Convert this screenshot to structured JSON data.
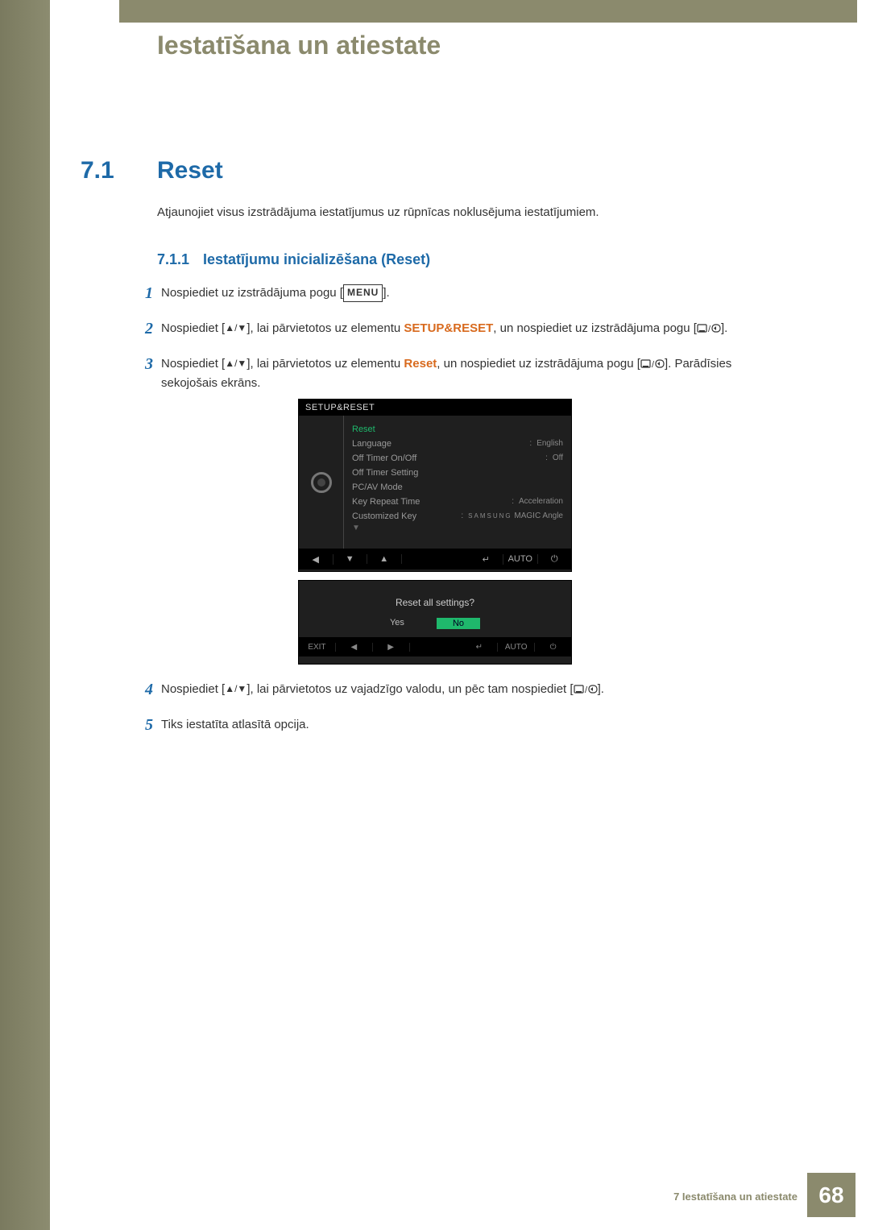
{
  "chapter_title": "Iestatīšana un atiestate",
  "section": {
    "num": "7.1",
    "title": "Reset"
  },
  "intro": "Atjaunojiet visus izstrādājuma iestatījumus uz rūpnīcas noklusējuma iestatījumiem.",
  "subsection": {
    "num": "7.1.1",
    "title": "Iestatījumu inicializēšana (Reset)"
  },
  "steps_top": [
    {
      "n": "1",
      "pre": "Nospiediet uz izstrādājuma pogu [",
      "icon": "menu",
      "post": "]."
    },
    {
      "n": "2",
      "pre": "Nospiediet [",
      "icon": "updown",
      "mid1": "], lai pārvietotos uz elementu ",
      "hl": "SETUP&RESET",
      "mid2": ", un nospiediet uz izstrādājuma pogu [",
      "icon2": "select-return",
      "post": "]."
    },
    {
      "n": "3",
      "pre": "Nospiediet [",
      "icon": "updown",
      "mid1": "], lai pārvietotos uz elementu ",
      "hl": "Reset",
      "mid2": ", un nospiediet uz izstrādājuma pogu [",
      "icon2": "select-return",
      "post": "]. Parādīsies sekojošais ekrāns."
    }
  ],
  "steps_bottom": [
    {
      "n": "4",
      "pre": "Nospiediet [",
      "icon": "updown",
      "mid1": "], lai pārvietotos uz vajadzīgo valodu, un pēc tam nospiediet [",
      "icon2": "select-return",
      "post": "]."
    },
    {
      "n": "5",
      "text": "Tiks iestatīta atlasītā opcija."
    }
  ],
  "menu_label": "MENU",
  "osd1": {
    "title": "SETUP&RESET",
    "rows": [
      {
        "label": "Reset",
        "val": "",
        "sel": true
      },
      {
        "label": "Language",
        "val": "English"
      },
      {
        "label": "Off Timer On/Off",
        "val": "Off"
      },
      {
        "label": "Off Timer Setting",
        "val": ""
      },
      {
        "label": "PC/AV Mode",
        "val": ""
      },
      {
        "label": "Key Repeat Time",
        "val": "Acceleration"
      },
      {
        "label": "Customized Key",
        "val": "MAGIC Angle",
        "brand": "SAMSUNG"
      }
    ],
    "ctrl": [
      "◀",
      "▼",
      "▲",
      "↵",
      "AUTO",
      "⏻"
    ]
  },
  "osd2": {
    "msg": "Reset all settings?",
    "yes": "Yes",
    "no": "No",
    "ctrl": [
      "EXIT",
      "◀",
      "▶",
      "",
      "↵",
      "AUTO",
      "⏻"
    ]
  },
  "footer": {
    "label": "7 Iestatīšana un atiestate",
    "page": "68"
  }
}
